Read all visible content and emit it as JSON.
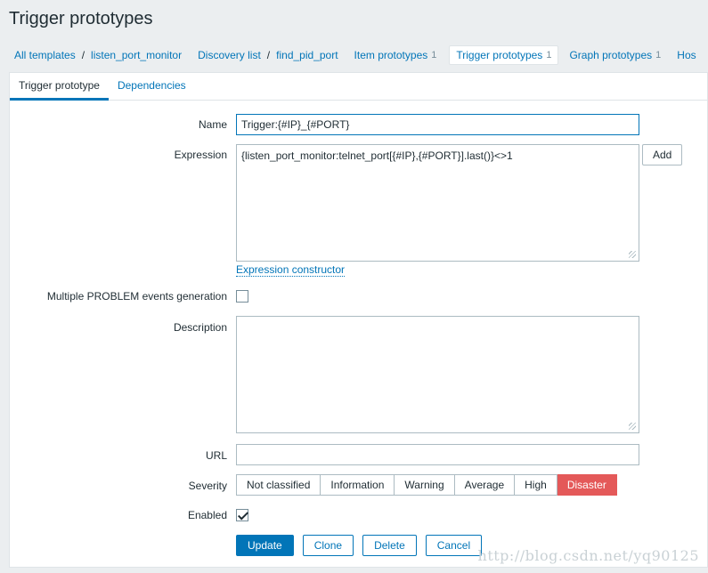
{
  "page": {
    "title": "Trigger prototypes"
  },
  "breadcrumbs": {
    "all_templates": "All templates",
    "template": "listen_port_monitor",
    "discovery_list": "Discovery list",
    "discovery_rule": "find_pid_port"
  },
  "nav_tabs": [
    {
      "label": "Item prototypes",
      "count": "1"
    },
    {
      "label": "Trigger prototypes",
      "count": "1"
    },
    {
      "label": "Graph prototypes",
      "count": "1"
    },
    {
      "label": "Hos"
    }
  ],
  "form_tabs": {
    "trigger_prototype": "Trigger prototype",
    "dependencies": "Dependencies"
  },
  "form": {
    "name_label": "Name",
    "name_value": "Trigger:{#IP}_{#PORT}",
    "expression_label": "Expression",
    "expression_value": "{listen_port_monitor:telnet_port[{#IP},{#PORT}].last()}<>1",
    "add_button": "Add",
    "expression_constructor": "Expression constructor",
    "multiple_problem_label": "Multiple PROBLEM events generation",
    "multiple_problem_checked": false,
    "description_label": "Description",
    "description_value": "",
    "url_label": "URL",
    "url_value": "",
    "severity_label": "Severity",
    "severity_options": [
      "Not classified",
      "Information",
      "Warning",
      "Average",
      "High",
      "Disaster"
    ],
    "severity_selected": "Disaster",
    "enabled_label": "Enabled",
    "enabled_checked": true
  },
  "actions": {
    "update": "Update",
    "clone": "Clone",
    "delete": "Delete",
    "cancel": "Cancel"
  },
  "watermark": "http://blog.csdn.net/yq90125",
  "colors": {
    "accent": "#0275b8",
    "disaster": "#e45959",
    "background": "#ebeef0"
  }
}
